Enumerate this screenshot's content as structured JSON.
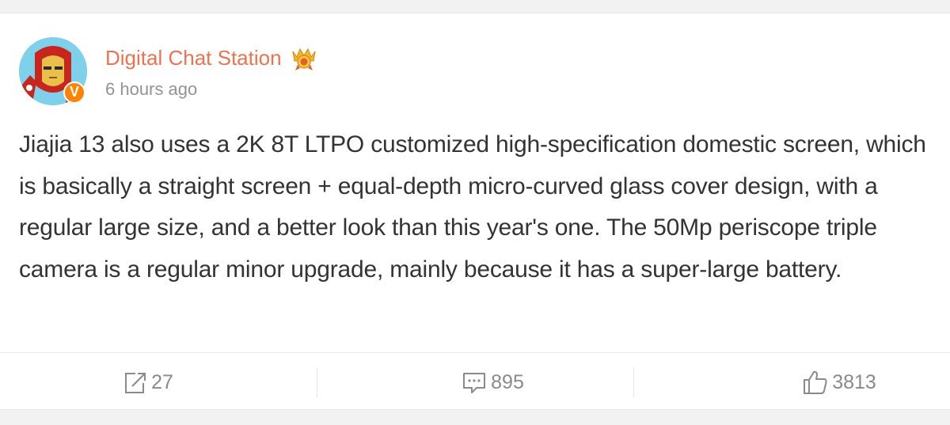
{
  "post": {
    "author": {
      "name": "Digital Chat Station",
      "verified_badge": "V",
      "badge_icon": "crown-badge-icon"
    },
    "timestamp": "6 hours ago",
    "text": "Jiajia 13 also uses a 2K 8T LTPO customized high-specification domestic screen, which is basically a straight screen + equal-depth micro-curved glass cover design, with a regular large size, and a better look than this year's one. The 50Mp periscope triple camera is a regular minor upgrade, mainly because it has a super-large battery."
  },
  "actions": {
    "repost": {
      "icon": "repost-icon",
      "count": "27"
    },
    "comment": {
      "icon": "comment-icon",
      "count": "895"
    },
    "like": {
      "icon": "thumbs-up-icon",
      "count": "3813"
    }
  },
  "colors": {
    "author_name": "#eb7350",
    "verified": "#ff8200",
    "text": "#333333",
    "meta": "#939393"
  }
}
